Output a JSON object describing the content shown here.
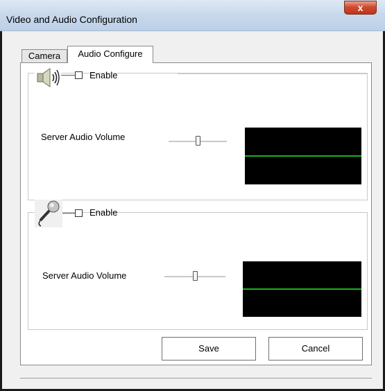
{
  "window": {
    "title": "Video and Audio Configuration",
    "close_glyph": "x"
  },
  "tabs": [
    {
      "label": "Camera",
      "selected": false
    },
    {
      "label": "Audio Configure",
      "selected": true
    }
  ],
  "speaker_section": {
    "icon": "speaker-icon",
    "enable_label": "Enable",
    "enable_checked": false,
    "volume_label": "Server Audio Volume",
    "volume_level": 0.5
  },
  "microphone_section": {
    "icon": "microphone-icon",
    "enable_label": "Enable",
    "enable_checked": false,
    "volume_label": "Server Audio Volume",
    "volume_level": 0.5
  },
  "buttons": {
    "save_label": "Save",
    "cancel_label": "Cancel"
  },
  "colors": {
    "scope_background": "#000000",
    "scope_line": "#1db31d",
    "close_button": "#c0341a"
  }
}
